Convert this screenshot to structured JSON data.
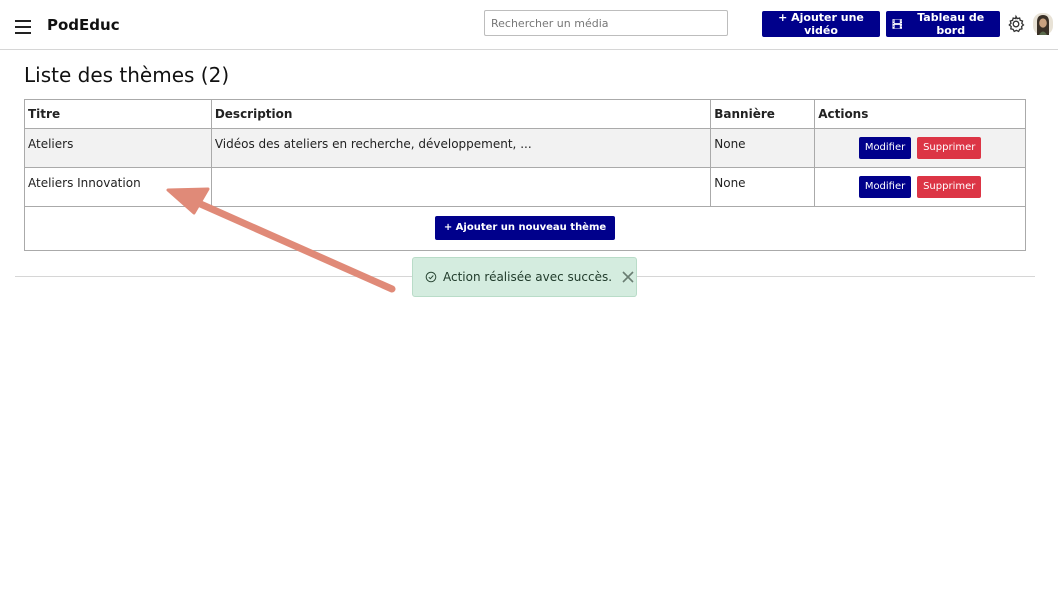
{
  "header": {
    "brand": "PodEduc",
    "search_placeholder": "Rechercher un média",
    "add_video_label": "+ Ajouter une vidéo",
    "dashboard_label": "Tableau de bord"
  },
  "page": {
    "title": "Liste des thèmes (2)"
  },
  "table": {
    "columns": [
      "Titre",
      "Description",
      "Bannière",
      "Actions"
    ],
    "rows": [
      {
        "title": "Ateliers",
        "description": "Vidéos des ateliers en recherche, développement, ...",
        "banner": "None"
      },
      {
        "title": "Ateliers Innovation",
        "description": "",
        "banner": "None"
      }
    ],
    "edit_label": "Modifier",
    "delete_label": "Supprimer",
    "add_theme_label": "+ Ajouter un nouveau thème"
  },
  "toast": {
    "message": "Action réalisée avec succès."
  },
  "colors": {
    "primary": "#00008b",
    "danger": "#dc3545",
    "success_bg": "#d4ecdf",
    "annotation_arrow": "#e08a78"
  }
}
